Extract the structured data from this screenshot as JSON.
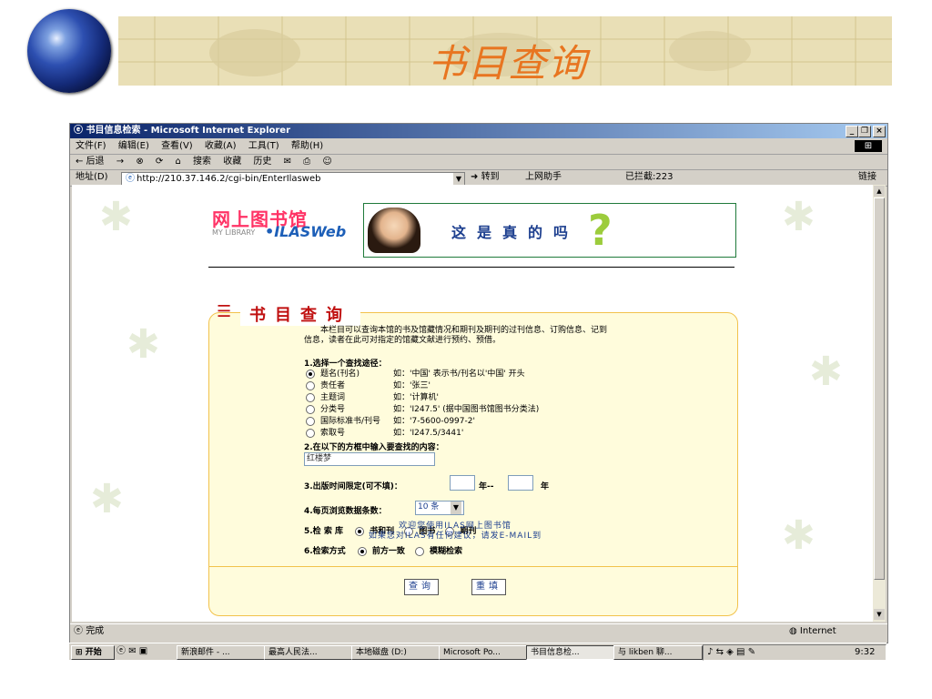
{
  "slide": {
    "title": "书目查询"
  },
  "window": {
    "title": "书目信息检索 - Microsoft Internet Explorer",
    "buttons": [
      "_",
      "❐",
      "×"
    ],
    "menu": [
      "文件(F)",
      "编辑(E)",
      "查看(V)",
      "收藏(A)",
      "工具(T)",
      "帮助(H)"
    ],
    "toolbar": [
      "← 后退",
      "→",
      "⊗",
      "⟳",
      "⌂",
      "搜索",
      "收藏",
      "历史"
    ],
    "address_label": "地址(D)",
    "address": "http://210.37.146.2/cgi-bin/EnterIlasweb",
    "go": "转到",
    "helper": "上网助手",
    "blocked": "已拦截:223",
    "links": "链接"
  },
  "page": {
    "logo_main": "网上图书馆",
    "logo_sub": "MY LIBRARY",
    "logo_ilas": "•ILASWeb",
    "ad_text": "这是真的吗",
    "ad_mark": "?",
    "panel_title": "书目查询",
    "intro": "本栏目可以查询本馆的书及馆藏情况和期刊及期刊的过刊信息、订购信息、记到信息，读者在此可对指定的馆藏文献进行预约、预借。",
    "step1": "1.选择一个查找途径：",
    "options": [
      {
        "label": "题名(刊名)",
        "hint": "如：'中国' 表示书/刊名以'中国' 开头",
        "selected": true
      },
      {
        "label": "责任者",
        "hint": "如：'张三'",
        "selected": false
      },
      {
        "label": "主题词",
        "hint": "如：'计算机'",
        "selected": false
      },
      {
        "label": "分类号",
        "hint": "如：'I247.5' (据中国图书馆图书分类法)",
        "selected": false
      },
      {
        "label": "国际标准书/刊号",
        "hint": "如：'7-5600-0997-2'",
        "selected": false
      },
      {
        "label": "索取号",
        "hint": "如：'I247.5/3441'",
        "selected": false
      }
    ],
    "step2": "2.在以下的方框中输入要查找的内容：",
    "query_value": "红楼梦",
    "step3": "3.出版时间限定(可不填)：",
    "year_sep": "年--",
    "year_end": "年",
    "step4": "4.每页浏览数据条数：",
    "per_page": "10 条",
    "step5": "5.检 索 库",
    "db_options": [
      {
        "label": "书和刊",
        "selected": true
      },
      {
        "label": "图书",
        "selected": false
      },
      {
        "label": "期刊",
        "selected": false
      }
    ],
    "step6": "6.检索方式",
    "mode_options": [
      {
        "label": "前方一致",
        "selected": true
      },
      {
        "label": "模糊检索",
        "selected": false
      }
    ],
    "search_btn": "查询",
    "reset_btn": "重填",
    "footer1": "欢迎您使用ILAS网上图书馆",
    "footer2": "如果您对ILAS有任何建议，请发E-MAIL到"
  },
  "status": {
    "left": "完成",
    "zone": "Internet"
  },
  "taskbar": {
    "start": "开始",
    "tasks": [
      "新浪邮件 - ...",
      "最高人民法...",
      "本地磁盘 (D:)",
      "Microsoft Po...",
      "书目信息检...",
      "与 likben 聊..."
    ],
    "active_index": 4,
    "clock": "9:32"
  }
}
